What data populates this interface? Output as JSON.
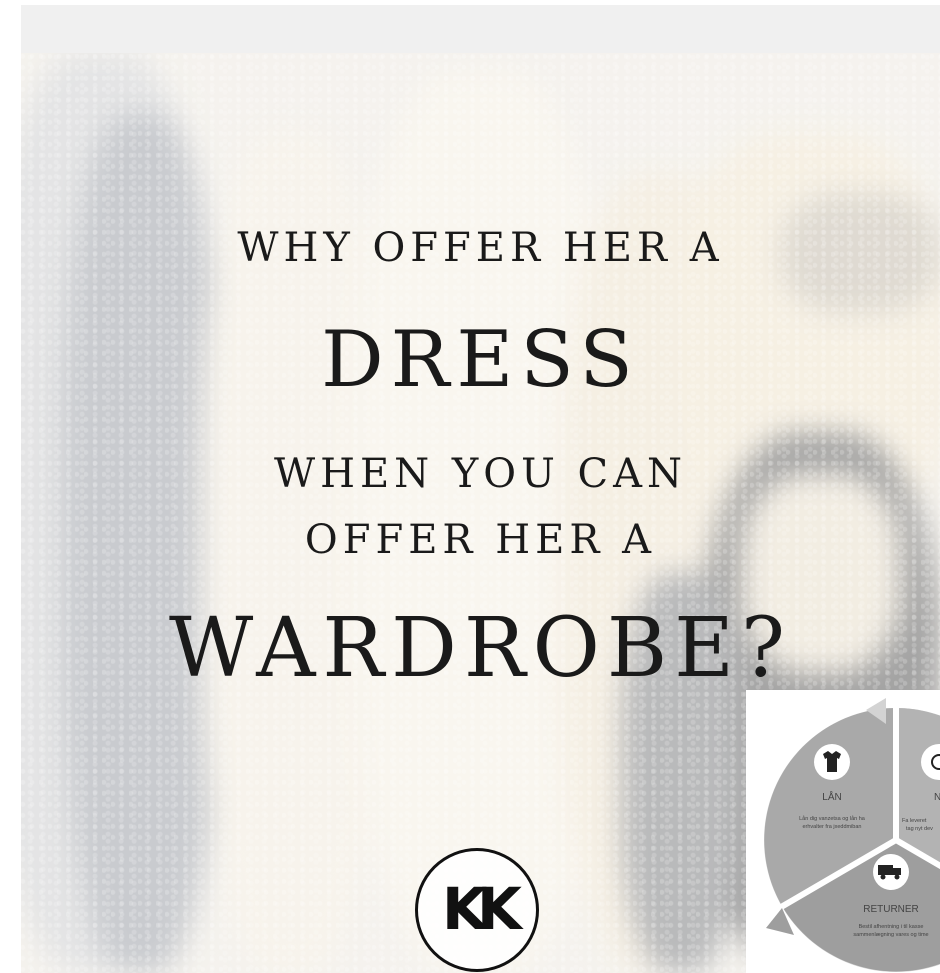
{
  "poster": {
    "line1": "WHY OFFER HER A",
    "line2": "DRESS",
    "line3": "WHEN YOU CAN",
    "line4": "OFFER HER A",
    "line5": "WARDROBE?",
    "logo_text": "KK"
  },
  "infographic": {
    "segments": [
      {
        "label": "LÅN",
        "icon": "shirt-icon",
        "desc_1": "Lån dig vanzetsa og lån ha",
        "desc_2": "erhvalter fra jxeddmiban"
      },
      {
        "label": "N",
        "icon": "clock-icon",
        "desc_1": "Fa leveret",
        "desc_2": "tag nyt dev"
      },
      {
        "label": "RETURNER",
        "icon": "truck-icon",
        "desc_1": "Bestil afhentning i til kasse",
        "desc_2": "sammenlægning vares og time"
      }
    ]
  }
}
